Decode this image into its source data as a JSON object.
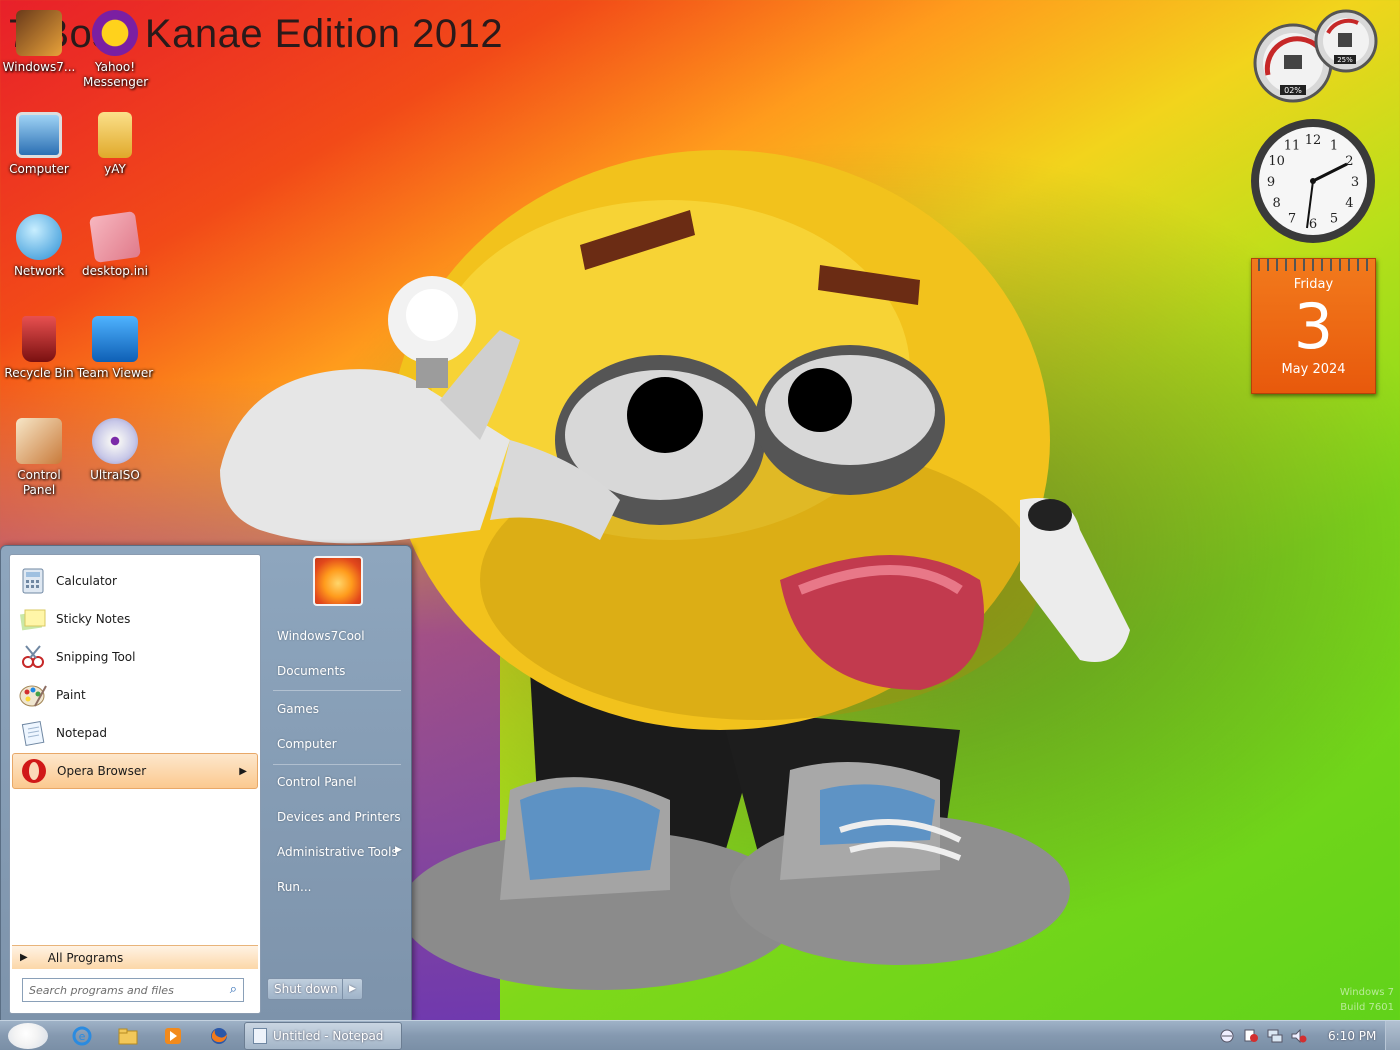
{
  "wallpaper": {
    "title": "7 Boss Kanae Edition 2012",
    "watermark_line1": "Windows 7",
    "watermark_line2": "Build 7601"
  },
  "desktop_icons": [
    {
      "label": "Windows7...",
      "icon": "windows7-shortcut-icon"
    },
    {
      "label": "Yahoo! Messenger",
      "icon": "yahoo-messenger-icon"
    },
    {
      "label": "Computer",
      "icon": "computer-icon"
    },
    {
      "label": "yAY",
      "icon": "folder-icon"
    },
    {
      "label": "Network",
      "icon": "network-icon"
    },
    {
      "label": "desktop.ini",
      "icon": "ini-file-icon"
    },
    {
      "label": "Recycle Bin",
      "icon": "recycle-bin-icon"
    },
    {
      "label": "Team Viewer",
      "icon": "teamviewer-icon"
    },
    {
      "label": "Control Panel",
      "icon": "control-panel-icon"
    },
    {
      "label": "UltraISO",
      "icon": "ultraiso-icon"
    }
  ],
  "gadgets": {
    "meter": {
      "cpu": "02%",
      "memory": "25%"
    },
    "clock": {
      "hour_numbers": [
        "12",
        "1",
        "2",
        "3",
        "4",
        "5",
        "6",
        "7",
        "8",
        "9",
        "10",
        "11"
      ]
    },
    "calendar": {
      "weekday": "Friday",
      "day": "3",
      "month_year": "May 2024"
    }
  },
  "start_menu": {
    "pinned": [
      {
        "label": "Calculator",
        "icon": "calculator-icon"
      },
      {
        "label": "Sticky Notes",
        "icon": "sticky-notes-icon"
      },
      {
        "label": "Snipping Tool",
        "icon": "snipping-tool-icon"
      },
      {
        "label": "Paint",
        "icon": "paint-icon"
      },
      {
        "label": "Notepad",
        "icon": "notepad-icon"
      },
      {
        "label": "Opera Browser",
        "icon": "opera-icon",
        "submenu": true,
        "highlighted": true
      }
    ],
    "all_programs": "All Programs",
    "search_placeholder": "Search programs and files",
    "right_links": [
      {
        "label": "Windows7Cool"
      },
      {
        "label": "Documents"
      },
      {
        "label": "Games"
      },
      {
        "label": "Computer"
      },
      {
        "label": "Control Panel"
      },
      {
        "label": "Devices and Printers"
      },
      {
        "label": "Administrative Tools",
        "submenu": true
      },
      {
        "label": "Run..."
      }
    ],
    "shutdown_label": "Shut down"
  },
  "taskbar": {
    "pinned": [
      "internet-explorer-icon",
      "explorer-folder-icon",
      "media-player-icon",
      "firefox-icon"
    ],
    "active_task": "Untitled - Notepad",
    "tray_icons": [
      "language-icon",
      "action-center-icon",
      "network-tray-icon",
      "volume-muted-icon"
    ],
    "time": "6:10 PM"
  },
  "colors": {
    "start_menu_panel": "#7d93ab",
    "highlight": "#fbc98f",
    "calendar_orange": "#e8590c"
  }
}
